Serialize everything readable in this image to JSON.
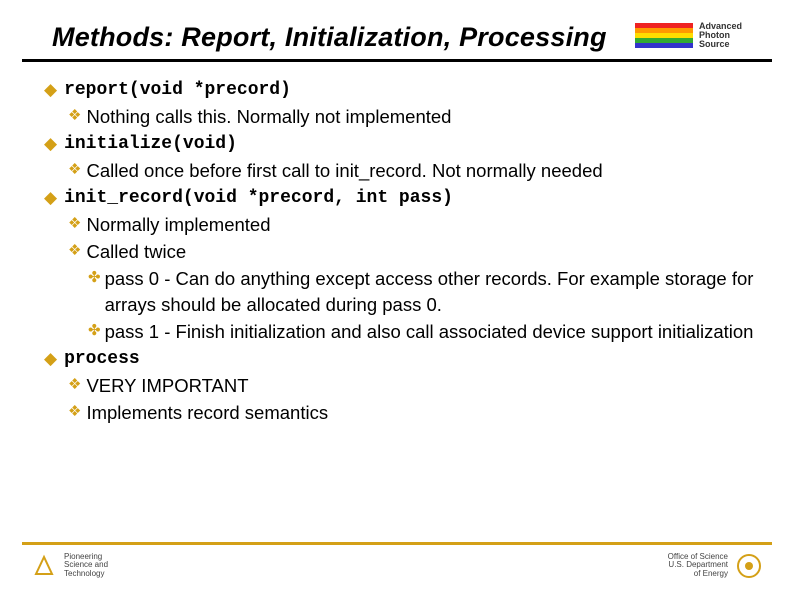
{
  "title": "Methods: Report, Initialization, Processing",
  "aps_logo": {
    "line1": "Advanced",
    "line2": "Photon",
    "line3": "Source"
  },
  "items": [
    {
      "code": "report(void *precord)",
      "subs": [
        {
          "text": "Nothing calls this. Normally not implemented"
        }
      ]
    },
    {
      "code": "initialize(void)",
      "subs": [
        {
          "text": "Called once before first call to init_record. Not normally needed"
        }
      ]
    },
    {
      "code": "init_record(void *precord, int pass)",
      "subs": [
        {
          "text": "Normally implemented"
        },
        {
          "text": "Called twice",
          "subs": [
            {
              "text": "pass 0 - Can do anything except access other records. For example storage for arrays should be allocated during pass 0."
            },
            {
              "text": "pass 1 - Finish initialization and also call associated device support initialization"
            }
          ]
        }
      ]
    },
    {
      "code": "process",
      "subs": [
        {
          "text": "VERY IMPORTANT"
        },
        {
          "text": "Implements record semantics"
        }
      ]
    }
  ],
  "footer": {
    "left": {
      "line1": "Pioneering",
      "line2": "Science and",
      "line3": "Technology"
    },
    "right": {
      "line1": "Office of Science",
      "line2": "U.S. Department",
      "line3": "of Energy"
    }
  }
}
